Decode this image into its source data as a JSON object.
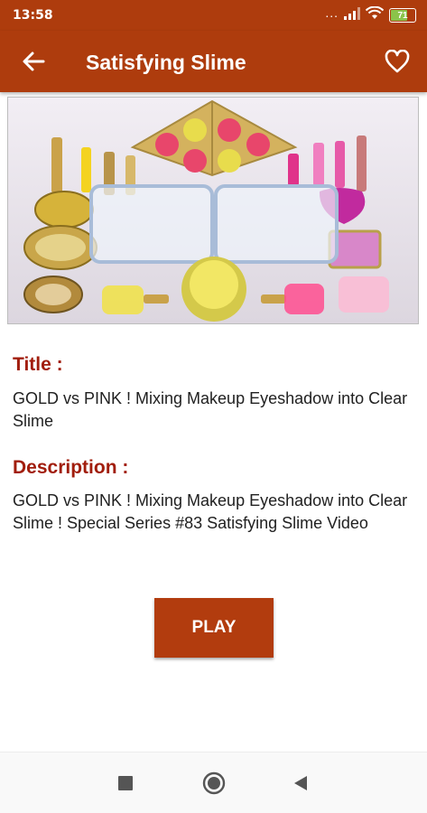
{
  "status_bar": {
    "time": "13:58",
    "signal_dots": "...",
    "battery_level": "71",
    "battery_percent": 71,
    "icons": [
      "signal-icon",
      "wifi-icon",
      "battery-icon"
    ]
  },
  "app_bar": {
    "title": "Satisfying Slime",
    "back_icon": "arrow-left-icon",
    "favorite_icon": "heart-outline-icon"
  },
  "video": {
    "thumbnail_alt": "Gold and pink makeup items surrounding two glass dishes of clear slime"
  },
  "details": {
    "title_label": "Title :",
    "title_text": "GOLD vs PINK ! Mixing Makeup Eyeshadow into Clear Slime",
    "description_label": "Description :",
    "description_text": "GOLD vs PINK ! Mixing Makeup Eyeshadow into Clear Slime ! Special Series #83 Satisfying Slime Video"
  },
  "actions": {
    "play_label": "PLAY"
  },
  "nav_bar": {
    "icons": [
      "recents-square-icon",
      "home-circle-icon",
      "back-triangle-icon"
    ]
  },
  "colors": {
    "primary": "#ae3c0d",
    "label_red": "#a11d0c",
    "battery_green": "#8bc34a"
  }
}
